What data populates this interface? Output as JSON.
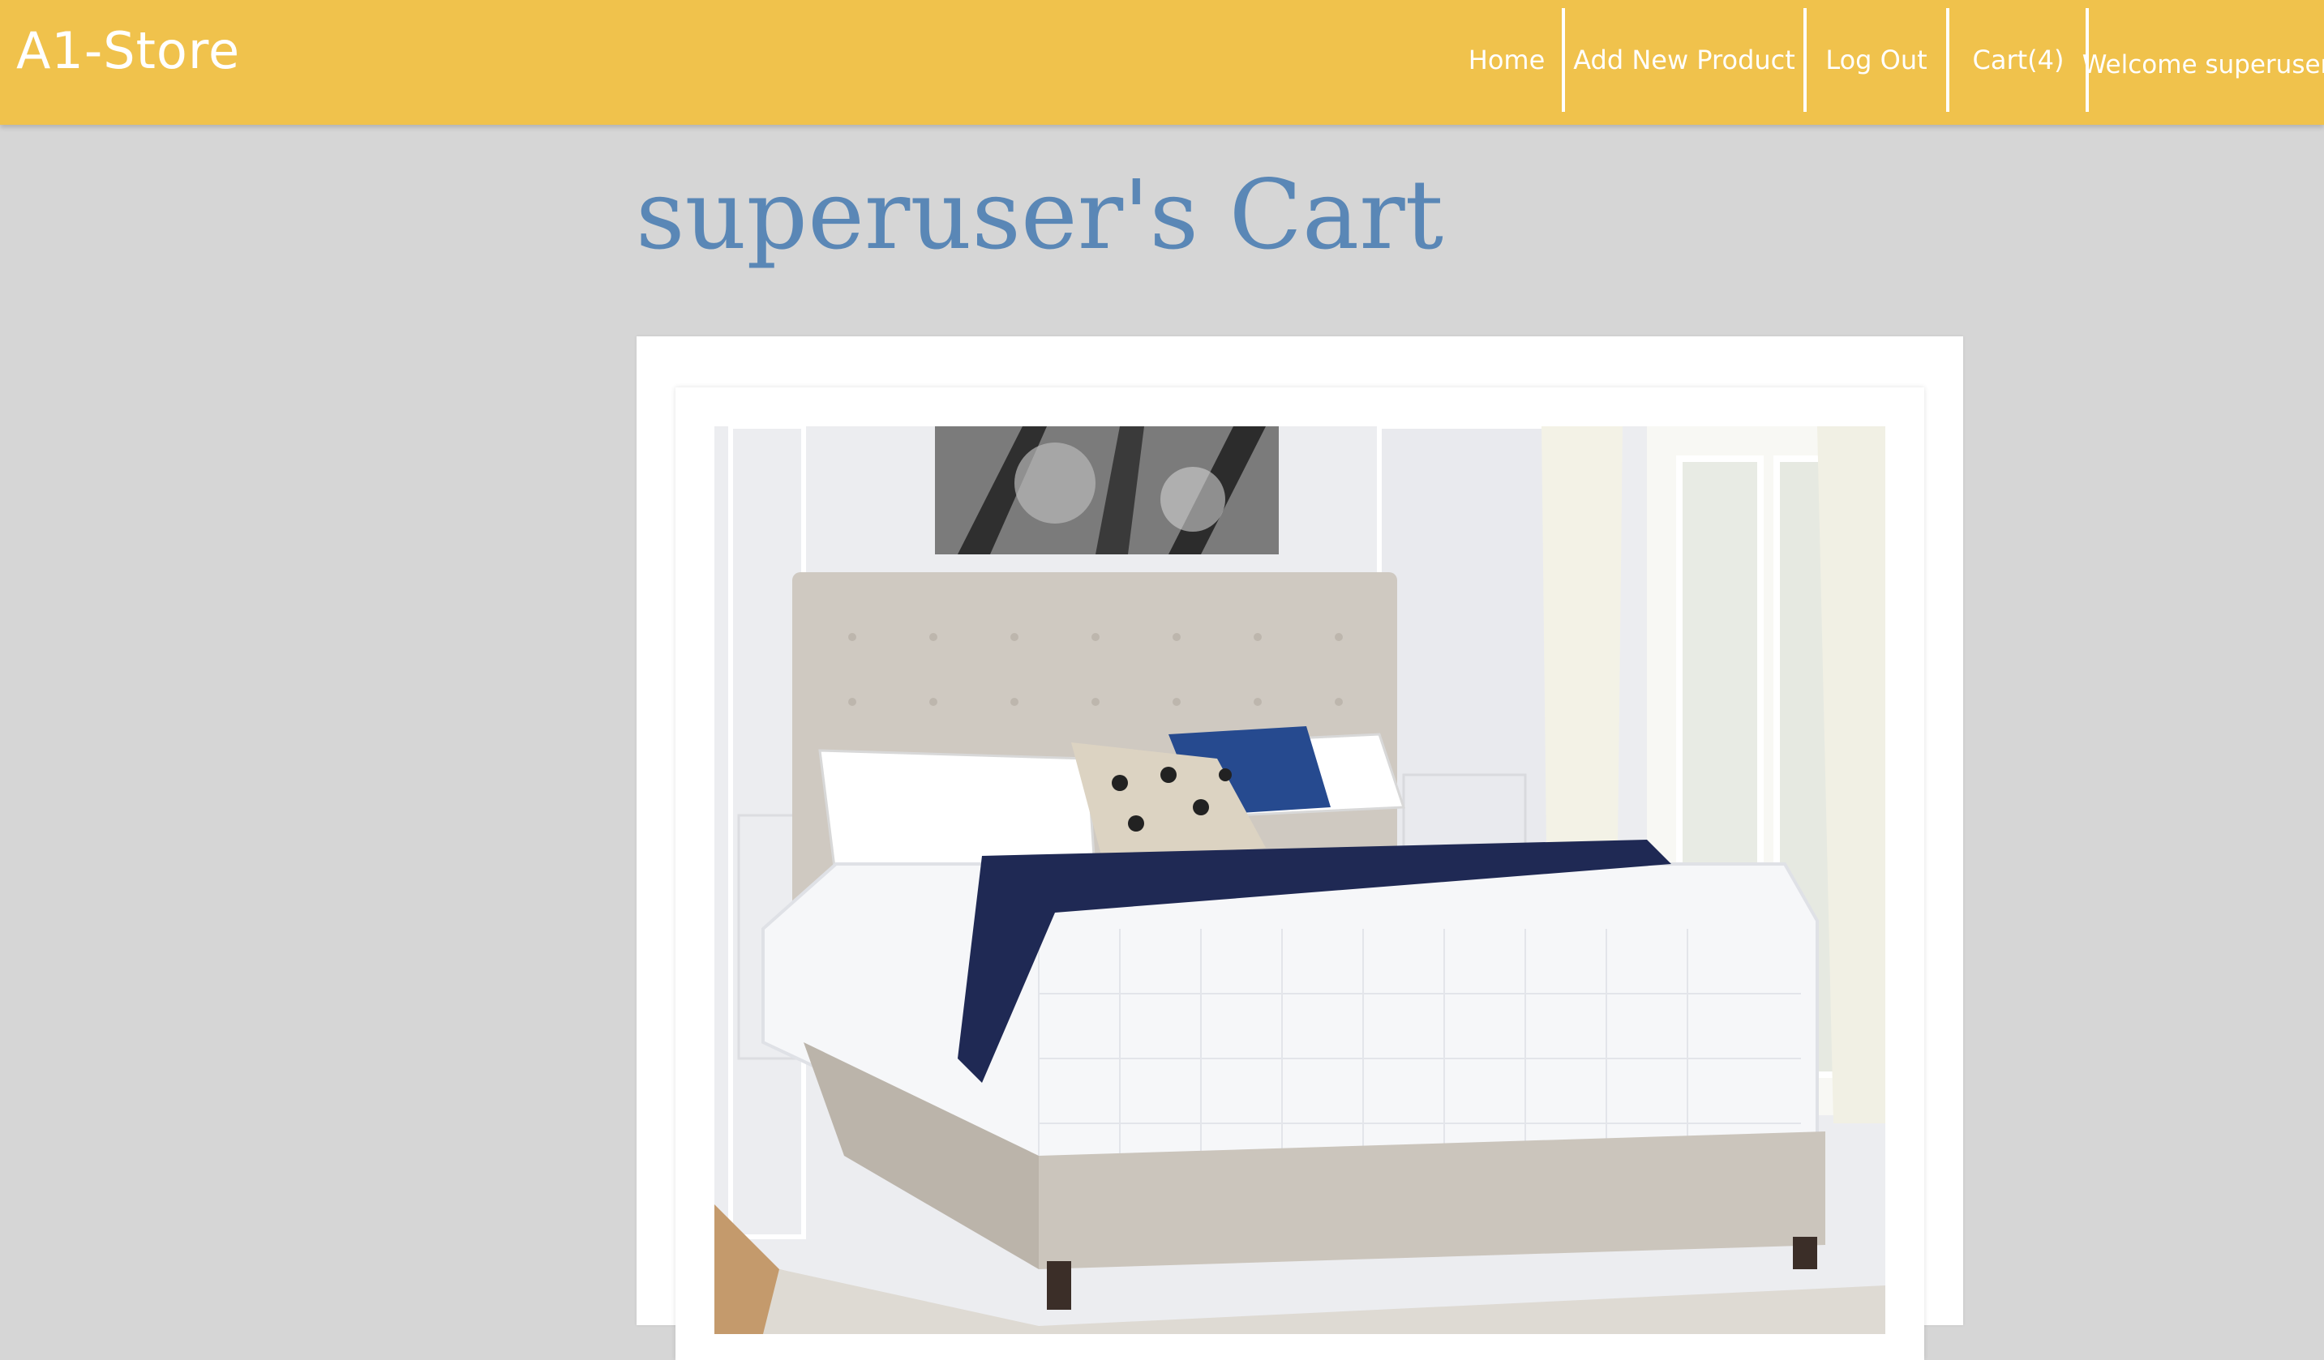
{
  "navbar": {
    "brand": "A1-Store",
    "links": {
      "home": "Home",
      "add_product": "Add New Product",
      "logout": "Log Out",
      "cart": "Cart(4)"
    },
    "welcome": "Welcome superuser"
  },
  "cart": {
    "title": "superuser's Cart",
    "items": [
      {
        "image_icon": "bed-product-image"
      }
    ]
  },
  "colors": {
    "navbar": "#f0c24c",
    "background": "#d6d6d6",
    "title": "#5a87b6",
    "nav_text": "#ffffff"
  }
}
